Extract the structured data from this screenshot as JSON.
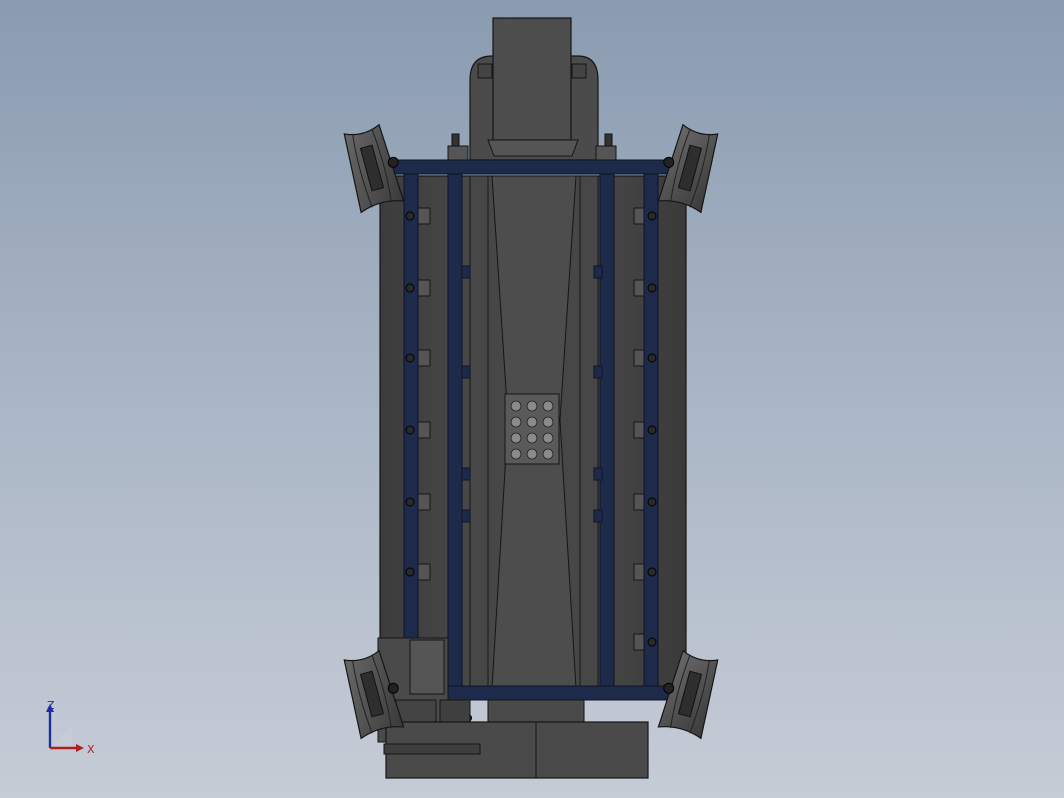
{
  "viewport": {
    "background_top": "#8a9bb0",
    "background_bottom": "#c6ccd6"
  },
  "model": {
    "body_color": "#4a4a4a",
    "frame_color": "#1e2a4a",
    "outline_color": "#151515"
  },
  "triad": {
    "z_label": "Z",
    "x_label": "X",
    "z_color": "#1a2fa0",
    "x_color": "#b02020"
  }
}
